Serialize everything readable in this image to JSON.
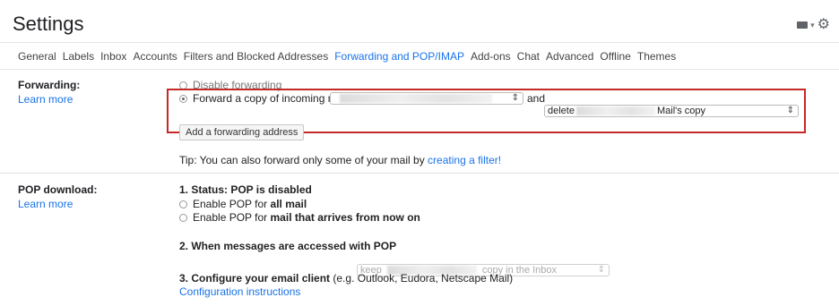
{
  "header": {
    "title": "Settings"
  },
  "tabs": [
    {
      "label": "General",
      "active": false
    },
    {
      "label": "Labels",
      "active": false
    },
    {
      "label": "Inbox",
      "active": false
    },
    {
      "label": "Accounts",
      "active": false
    },
    {
      "label": "Filters and Blocked Addresses",
      "active": false
    },
    {
      "label": "Forwarding and POP/IMAP",
      "active": true
    },
    {
      "label": "Add-ons",
      "active": false
    },
    {
      "label": "Chat",
      "active": false
    },
    {
      "label": "Advanced",
      "active": false
    },
    {
      "label": "Offline",
      "active": false
    },
    {
      "label": "Themes",
      "active": false
    }
  ],
  "forwarding": {
    "label": "Forwarding:",
    "learn_more": "Learn more",
    "disable_option": "Disable forwarding",
    "forward_option": "Forward a copy of incoming mail to",
    "and_text": "and",
    "action_select_start": "delete",
    "action_select_end": "Mail's copy",
    "add_button": "Add a forwarding address",
    "tip_text": "Tip: You can also forward only some of your mail by",
    "tip_link": "creating a filter!"
  },
  "pop": {
    "label": "POP download:",
    "learn_more": "Learn more",
    "status_heading": "1. Status: POP is disabled",
    "enable_all_prefix": "Enable POP for",
    "enable_all_bold": "all mail",
    "enable_new_prefix": "Enable POP for",
    "enable_new_bold": "mail that arrives from now on",
    "accessed_heading": "2. When messages are accessed with POP",
    "accessed_select_start": "keep",
    "accessed_select_end": "copy in the Inbox",
    "configure_heading": "3. Configure your email client",
    "configure_note": "(e.g. Outlook, Eudora, Netscape Mail)",
    "configure_link": "Configuration instructions"
  },
  "colors": {
    "accent": "#1a73e8",
    "highlight_border": "#c62828"
  },
  "icons": [
    "keyboard-icon",
    "dropdown-caret-icon",
    "gear-icon",
    "select-arrows-icon"
  ]
}
